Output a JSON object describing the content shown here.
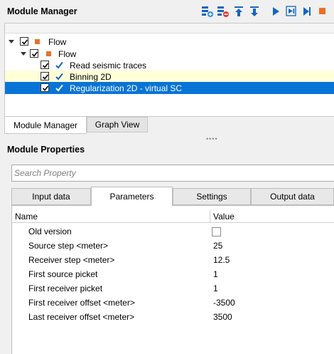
{
  "module_manager": {
    "title": "Module Manager",
    "toolbar_icons": [
      "add-module-icon",
      "remove-module-icon",
      "move-up-icon",
      "move-down-icon",
      "run-icon",
      "run-step-icon",
      "run-to-end-icon",
      "stop-icon"
    ]
  },
  "tree": {
    "items": [
      {
        "label": "Flow",
        "level": 0,
        "checked": true,
        "icon": "flow-square-icon"
      },
      {
        "label": "Flow",
        "level": 1,
        "checked": true,
        "icon": "flow-square-icon"
      },
      {
        "label": "Read seismic traces",
        "level": 2,
        "checked": true,
        "icon": "check-mark-icon"
      },
      {
        "label": "Binning 2D",
        "level": 2,
        "checked": true,
        "icon": "check-mark-icon",
        "highlighted": true
      },
      {
        "label": "Regularization 2D - virtual SC",
        "level": 2,
        "checked": true,
        "icon": "check-mark-icon",
        "selected": true
      }
    ]
  },
  "view_tabs": [
    {
      "label": "Module Manager",
      "active": true
    },
    {
      "label": "Graph View",
      "active": false
    }
  ],
  "module_properties": {
    "title": "Module Properties",
    "search_placeholder": "Search Property",
    "tabs": [
      {
        "label": "Input data",
        "active": false
      },
      {
        "label": "Parameters",
        "active": true
      },
      {
        "label": "Settings",
        "active": false
      },
      {
        "label": "Output data",
        "active": false
      }
    ],
    "columns": {
      "name": "Name",
      "value": "Value"
    },
    "rows": [
      {
        "name": "Old version",
        "value": "",
        "type": "checkbox",
        "checked": false
      },
      {
        "name": "Source step <meter>",
        "value": "25"
      },
      {
        "name": "Receiver step <meter>",
        "value": "12.5"
      },
      {
        "name": "First source picket",
        "value": "1"
      },
      {
        "name": "First receiver picket",
        "value": "1"
      },
      {
        "name": "First receiver offset <meter>",
        "value": "-3500"
      },
      {
        "name": "Last receiver offset <meter>",
        "value": "3500"
      }
    ]
  },
  "colors": {
    "selection": "#0a74d6",
    "highlight": "#ffffd8",
    "accent_orange": "#e8712b",
    "icon_blue": "#1565c0"
  }
}
